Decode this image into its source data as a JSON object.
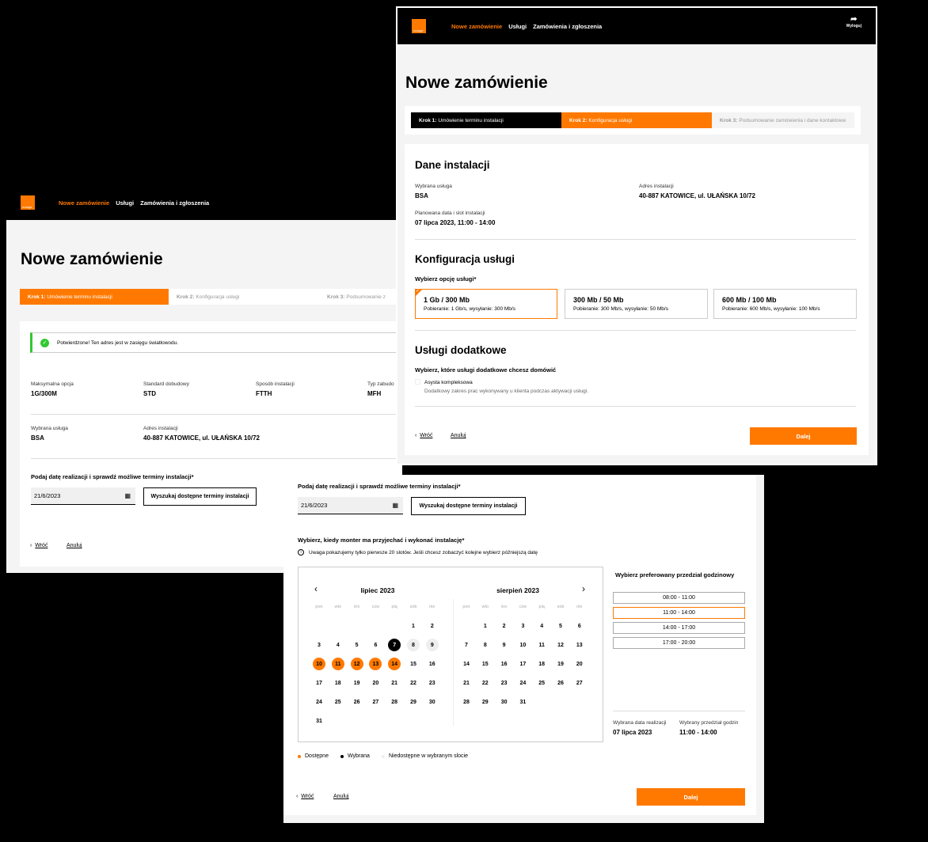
{
  "nav": {
    "logo_text": "orange",
    "links": [
      "Nowe zamówienie",
      "Usługi",
      "Zamówienia i zgłoszenia"
    ],
    "logout": "Wyloguj"
  },
  "page_title": "Nowe zamówienie",
  "steps": {
    "s1_bold": "Krok 1:",
    "s1_text": "Umówienie terminu instalacji",
    "s2_bold": "Krok 2:",
    "s2_text": "Konfiguracja usługi",
    "s3_bold": "Krok 3:",
    "s3_text": "Podsumowanie zamówienia i dane kontaktowe",
    "s3_text_cut": "Podsumowanie z"
  },
  "left": {
    "confirm_msg": "Potwierdzone! Ten adres jest w zasięgu światłowodu.",
    "fields": [
      {
        "label": "Maksymalna opcja",
        "value": "1G/300M"
      },
      {
        "label": "Standard dobudowy",
        "value": "STD"
      },
      {
        "label": "Sposób instalacji",
        "value": "FTTH"
      },
      {
        "label": "Typ zabudo",
        "value": "MFH"
      }
    ],
    "service_label": "Wybrana usługa",
    "service_value": "BSA",
    "address_label": "Adres instalacji",
    "address_value": "40-887 KATOWICE, ul. UŁAŃSKA 10/72",
    "date_prompt": "Podaj datę realizacji i sprawdź możliwe terminy instalacji*",
    "date_value": "21/6/2023",
    "search_btn": "Wyszukaj dostępne terminy instalacji",
    "back": "Wróć",
    "cancel": "Anuluj"
  },
  "right": {
    "install_title": "Dane instalacji",
    "service_label": "Wybrana usługa",
    "service_value": "BSA",
    "address_label": "Adres instalacji",
    "address_value": "40-887 KATOWICE, ul. UŁAŃSKA 10/72",
    "planned_label": "Planowana data i slot instalacji",
    "planned_value": "07 lipca 2023, 11:00 - 14:00",
    "config_title": "Konfiguracja usługi",
    "choose_opt": "Wybierz opcję usługi*",
    "options": [
      {
        "title": "1 Gb / 300 Mb",
        "sub": "Pobieranie: 1 Gb/s, wysyłanie: 300 Mb/s"
      },
      {
        "title": "300 Mb / 50 Mb",
        "sub": "Pobieranie: 300 Mb/s, wysyłanie: 50 Mb/s"
      },
      {
        "title": "600 Mb / 100 Mb",
        "sub": "Pobieranie: 600 Mb/s, wysyłanie: 100 Mb/s"
      }
    ],
    "extra_title": "Usługi dodatkowe",
    "extra_q": "Wybierz, które usługi dodatkowe chcesz domówić",
    "extra_name": "Asysta kompleksowa",
    "extra_desc": "Dodatkowy zakres prac wykonywany u klienta podczas aktywacji usługi.",
    "back": "Wróć",
    "cancel": "Anuluj",
    "next": "Dalej"
  },
  "bottom": {
    "date_prompt": "Podaj datę realizacji i sprawdź możliwe terminy instalacji*",
    "date_value": "21/6/2023",
    "search_btn": "Wyszukaj dostępne terminy instalacji",
    "when_q": "Wybierz, kiedy monter ma przyjechać i wykonać instalację*",
    "note": "Uwaga pokazujemy tylko pierwsze 20 slotów. Jeśli chcesz zobaczyć kolejne wybierz późniejszą datę",
    "month1": "lipiec 2023",
    "month2": "sierpień 2023",
    "dows": [
      "pon",
      "wto",
      "śro",
      "czw",
      "pią",
      "sob",
      "nie"
    ],
    "slot_title": "Wybierz preferowany przedział godzinowy",
    "slots": [
      "08:00 - 11:00",
      "11:00 - 14:00",
      "14:00 - 17:00",
      "17:00 - 20:00"
    ],
    "sel_date_label": "Wybrana data realizacji",
    "sel_date_value": "07 lipca 2023",
    "sel_slot_label": "Wybrany przedział godzin",
    "sel_slot_value": "11:00 - 14:00",
    "legend": [
      "Dostępne",
      "Wybrana",
      "Niedostępne w wybranym slocie"
    ],
    "back": "Wróć",
    "cancel": "Anuluj",
    "next": "Dalej"
  },
  "colors": {
    "accent": "#ff7900",
    "dark": "#000000",
    "success": "#32c832"
  }
}
